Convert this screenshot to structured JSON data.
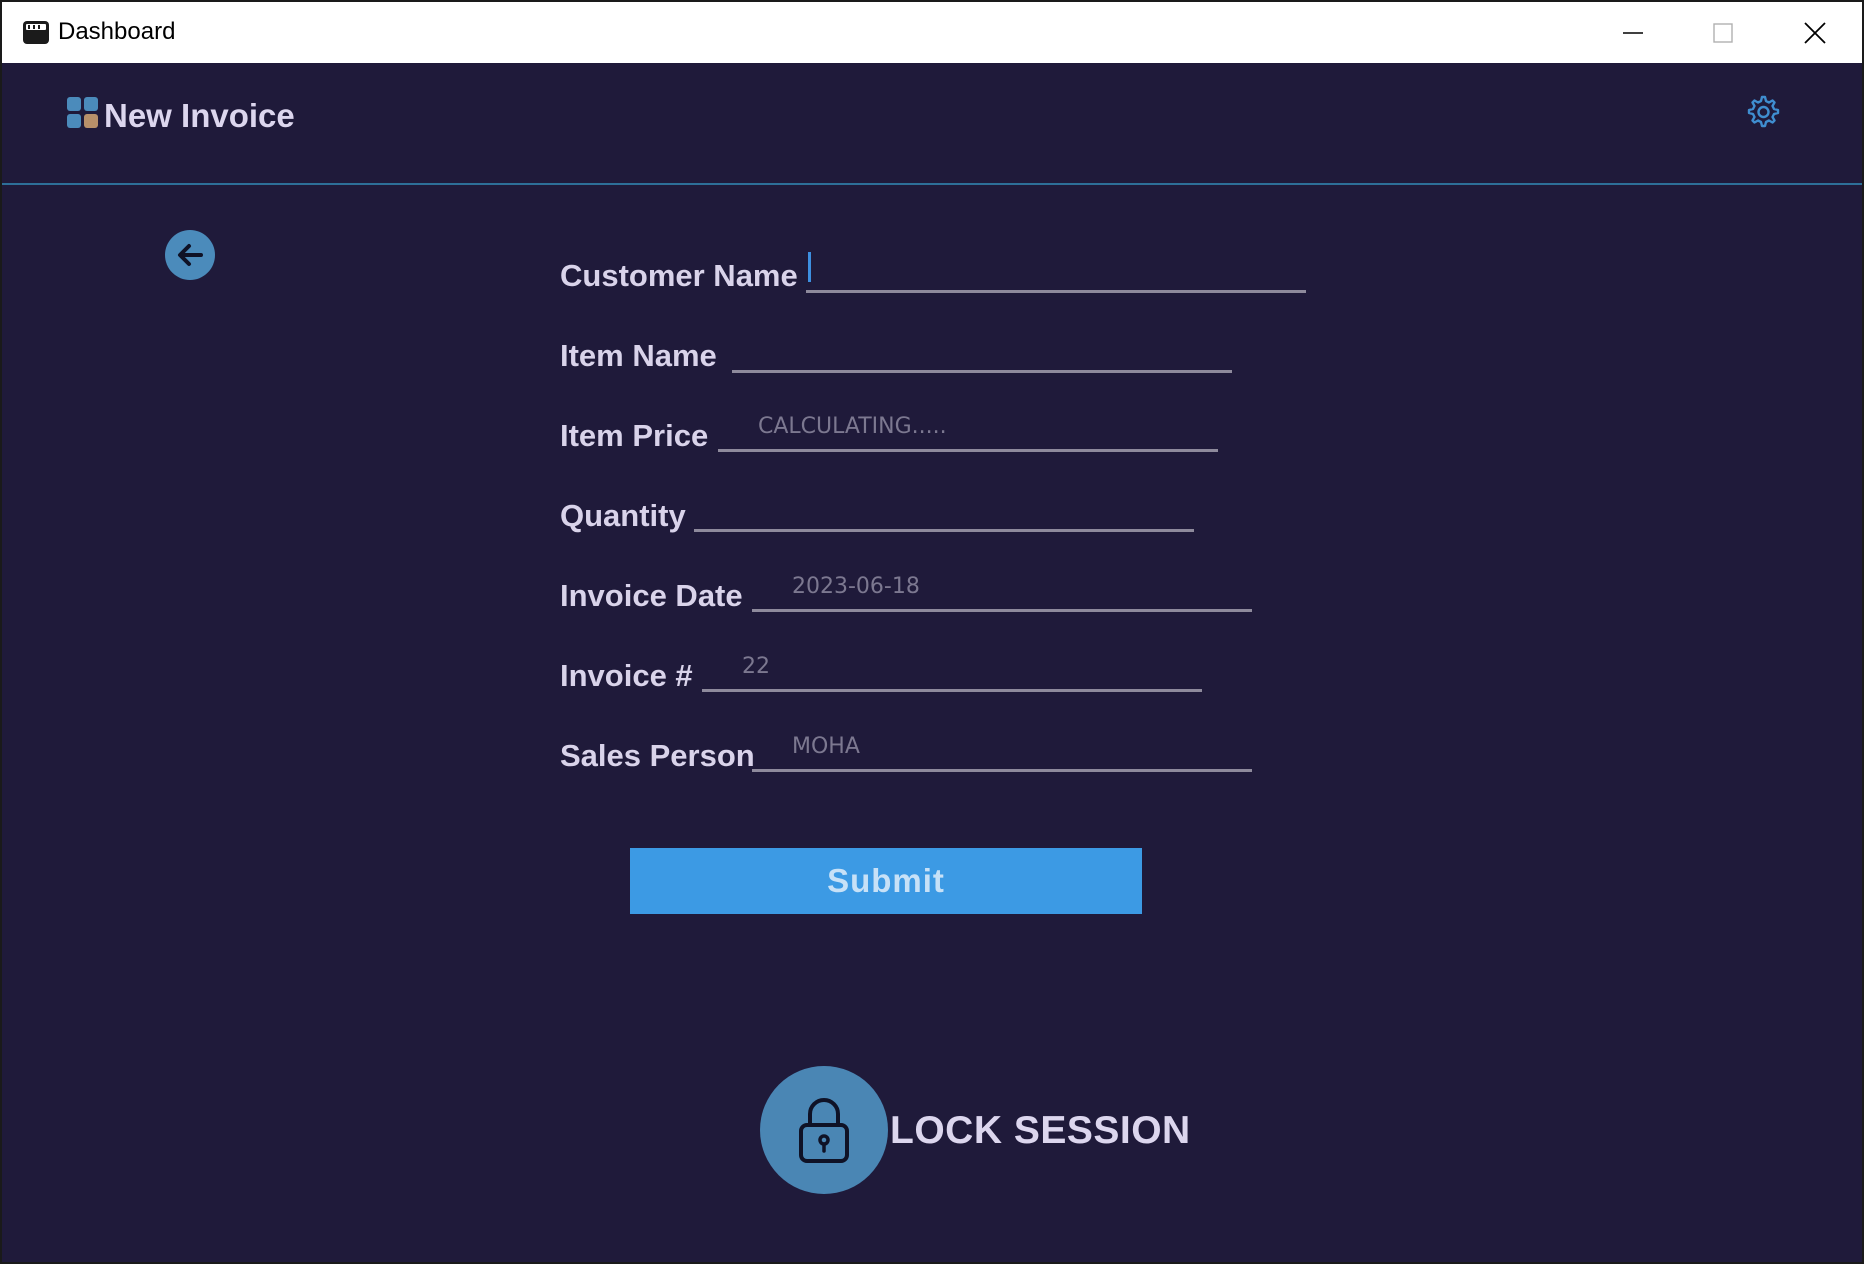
{
  "window": {
    "title": "Dashboard"
  },
  "header": {
    "title": "New Invoice"
  },
  "form": {
    "fields": [
      {
        "label": "Customer Name",
        "value": ""
      },
      {
        "label": "Item Name",
        "value": ""
      },
      {
        "label": "Item Price",
        "value": "CALCULATING....."
      },
      {
        "label": "Quantity",
        "value": ""
      },
      {
        "label": "Invoice Date",
        "value": "2023-06-18"
      },
      {
        "label": "Invoice #",
        "value": "22"
      },
      {
        "label": "Sales Person",
        "value": "MOHA"
      }
    ],
    "submit_label": "Submit"
  },
  "footer": {
    "lock_label": "LOCK SESSION"
  },
  "colors": {
    "background": "#1f1a3a",
    "accent": "#3c9ae4",
    "icon_circle": "#4a86b4"
  }
}
